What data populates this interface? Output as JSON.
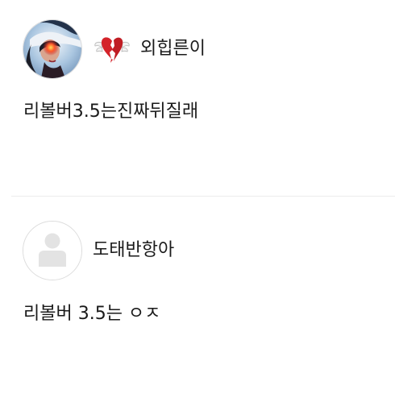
{
  "comments": [
    {
      "username": "외힙른이",
      "text": "리볼버3.5는진짜뒤질래",
      "has_badge": true,
      "avatar": "photo-avatar",
      "badge_icon": "winged-broken-heart-icon"
    },
    {
      "username": "도태반항아",
      "text": "리볼버 3.5는 ㅇㅈ",
      "has_badge": false,
      "avatar": "default-avatar-icon"
    }
  ],
  "colors": {
    "text": "#1a1a1a",
    "divider": "#ececec",
    "avatar_border": "#dcdcdc",
    "default_avatar_fill": "#e3e3e3",
    "heart_red": "#d4232a"
  }
}
